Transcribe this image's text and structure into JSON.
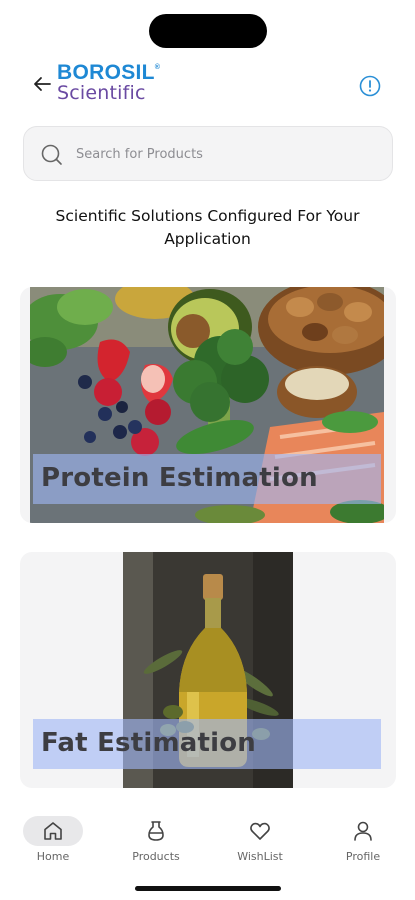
{
  "header": {
    "brand": "BOROSIL",
    "brand_mark": "®",
    "brand_sub": "Scientific",
    "back_icon": "arrow-left-icon",
    "info_icon": "info-icon",
    "colors": {
      "brand_blue": "#1e88d4",
      "brand_purple": "#6a4aa2",
      "info_blue": "#2a8fd6"
    }
  },
  "search": {
    "placeholder": "Search for Products",
    "value": "",
    "icon": "search-icon"
  },
  "tagline": "Scientific Solutions Configured For Your Application",
  "categories": [
    {
      "label": "Protein Estimation",
      "image": "protein-foods-photo"
    },
    {
      "label": "Fat Estimation",
      "image": "olive-oil-bottle-photo"
    }
  ],
  "tabbar": {
    "active": "Home",
    "items": [
      {
        "label": "Home",
        "icon": "home-icon"
      },
      {
        "label": "Products",
        "icon": "flask-icon"
      },
      {
        "label": "WishList",
        "icon": "heart-icon"
      },
      {
        "label": "Profile",
        "icon": "user-icon"
      }
    ]
  }
}
